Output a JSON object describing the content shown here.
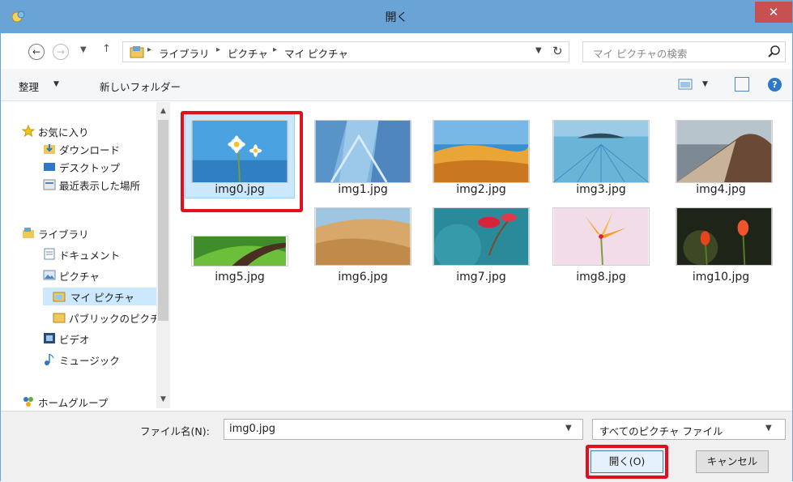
{
  "window": {
    "title": "開く"
  },
  "address": {
    "breadcrumb": [
      "ライブラリ",
      "ピクチャ",
      "マイ ピクチャ"
    ],
    "search_placeholder": "マイ ピクチャの検索"
  },
  "toolbar": {
    "organize": "整理",
    "new_folder": "新しいフォルダー"
  },
  "sidebar": {
    "items": [
      {
        "label": "お気に入り",
        "icon": "star-icon"
      },
      {
        "label": "ダウンロード",
        "icon": "download-folder-icon"
      },
      {
        "label": "デスクトップ",
        "icon": "desktop-icon"
      },
      {
        "label": "最近表示した場所",
        "icon": "recent-places-icon"
      },
      {
        "label": "ライブラリ",
        "icon": "library-icon"
      },
      {
        "label": "ドキュメント",
        "icon": "documents-icon"
      },
      {
        "label": "ピクチャ",
        "icon": "pictures-icon"
      },
      {
        "label": "マイ ピクチャ",
        "icon": "folder-icon",
        "selected": true
      },
      {
        "label": "パブリックのピクチ",
        "icon": "folder-icon"
      },
      {
        "label": "ビデオ",
        "icon": "videos-icon"
      },
      {
        "label": "ミュージック",
        "icon": "music-icon"
      },
      {
        "label": "ホームグループ",
        "icon": "homegroup-icon"
      }
    ]
  },
  "files": [
    {
      "name": "img0.jpg",
      "selected": true
    },
    {
      "name": "img1.jpg"
    },
    {
      "name": "img2.jpg"
    },
    {
      "name": "img3.jpg"
    },
    {
      "name": "img4.jpg"
    },
    {
      "name": "img5.jpg"
    },
    {
      "name": "img6.jpg"
    },
    {
      "name": "img7.jpg"
    },
    {
      "name": "img8.jpg"
    },
    {
      "name": "img10.jpg"
    }
  ],
  "bottom": {
    "filename_label": "ファイル名(N):",
    "filename_value": "img0.jpg",
    "filetype_value": "すべてのピクチャ ファイル",
    "open_button": "開く(O)",
    "cancel_button": "キャンセル"
  },
  "colors": {
    "title_bar": "#6aa3d6",
    "close": "#c75050",
    "highlight": "#e0101e",
    "selection": "#cce8ff"
  }
}
